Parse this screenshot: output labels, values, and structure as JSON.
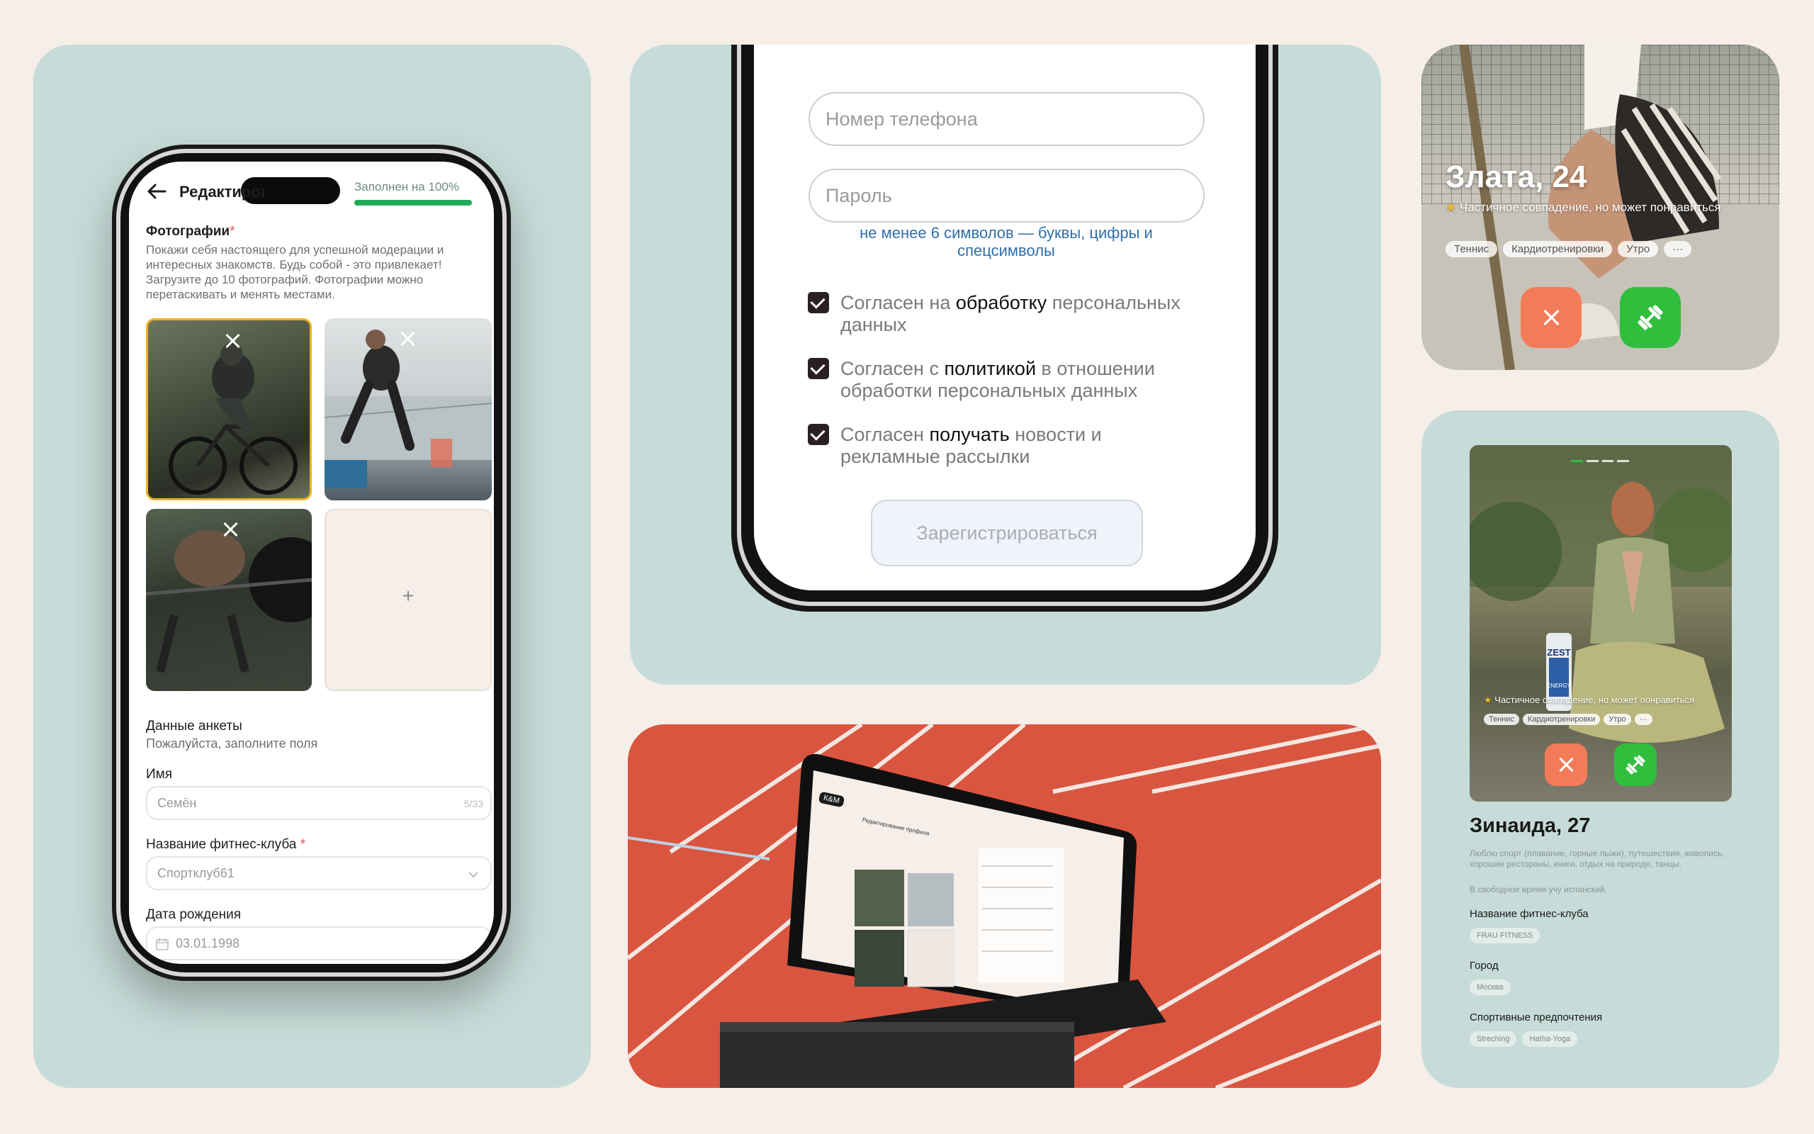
{
  "phone_edit": {
    "title": "Редактирование профиля",
    "progress_label": "Заполнен на 100%",
    "progress": 1.0,
    "photos_title": "Фотографии",
    "required_mark": "*",
    "photos_desc": "Покажи себя настоящего для успешной модерации и интересных знакомств. Будь собой - это привлекает! Загрузите до 10 фотографий. Фотографии можно перетаскивать и менять местами.",
    "add_symbol": "+",
    "section_title": "Данные анкеты",
    "section_subtitle": "Пожалуйста, заполните поля",
    "name_label": "Имя",
    "name_value": "Семён",
    "name_counter": "5/33",
    "club_label": "Название фитнес-клуба",
    "club_value": "Спортклуб61",
    "birth_label": "Дата рождения",
    "birth_value": "03.01.1998"
  },
  "phone_register": {
    "phone_placeholder": "Номер телефона",
    "password_placeholder": "Пароль",
    "password_hint": "не менее 6 символов — буквы, цифры и спецсимволы",
    "checks": [
      {
        "pre": "Согласен на ",
        "bold": "обработку",
        "post": " персональных данных"
      },
      {
        "pre": "Согласен с ",
        "bold": "политикой",
        "post": " в отношении обработки персональных данных"
      },
      {
        "pre": "Согласен ",
        "bold": "получать",
        "post": " новости и рекламные рассылки"
      }
    ],
    "submit_label": "Зарегистрироваться"
  },
  "card_zlata": {
    "name": "Злата, 24",
    "match_text": "Частичное совпадение, но может понравиться",
    "tags": [
      "Теннис",
      "Кардиотренировки",
      "Утро"
    ],
    "more": "···"
  },
  "card_zinaida": {
    "name": "Зинаида, 27",
    "match_text": "Частичное совпадение, но может понравиться",
    "tags": [
      "Теннис",
      "Кардиотренировки",
      "Утро"
    ],
    "more": "···",
    "bio": "Люблю спорт (плавание, горные лыжи), путешествия, живопись, хорошие рестораны, книги, отдых на природе, танцы.",
    "bio2": "В свободное время учу испанский.",
    "club_title": "Название фитнес-клуба",
    "club_value": "FRAU FITNESS",
    "city_title": "Город",
    "city_value": "Москва",
    "prefs_title": "Спортивные предпочтения",
    "prefs": [
      "Streching",
      "Hatha-Yoga"
    ],
    "can_label": "ZEST",
    "can_sub": "ENERGY"
  },
  "laptop": {
    "logo": "К&М",
    "screen_title": "Редактирование профиля"
  },
  "colors": {
    "mint": "#c7dcd8",
    "accent_green": "#2fbf3d",
    "dislike_orange": "#f47b58",
    "track_red": "#d9553f",
    "link_blue": "#2f6fa8"
  }
}
